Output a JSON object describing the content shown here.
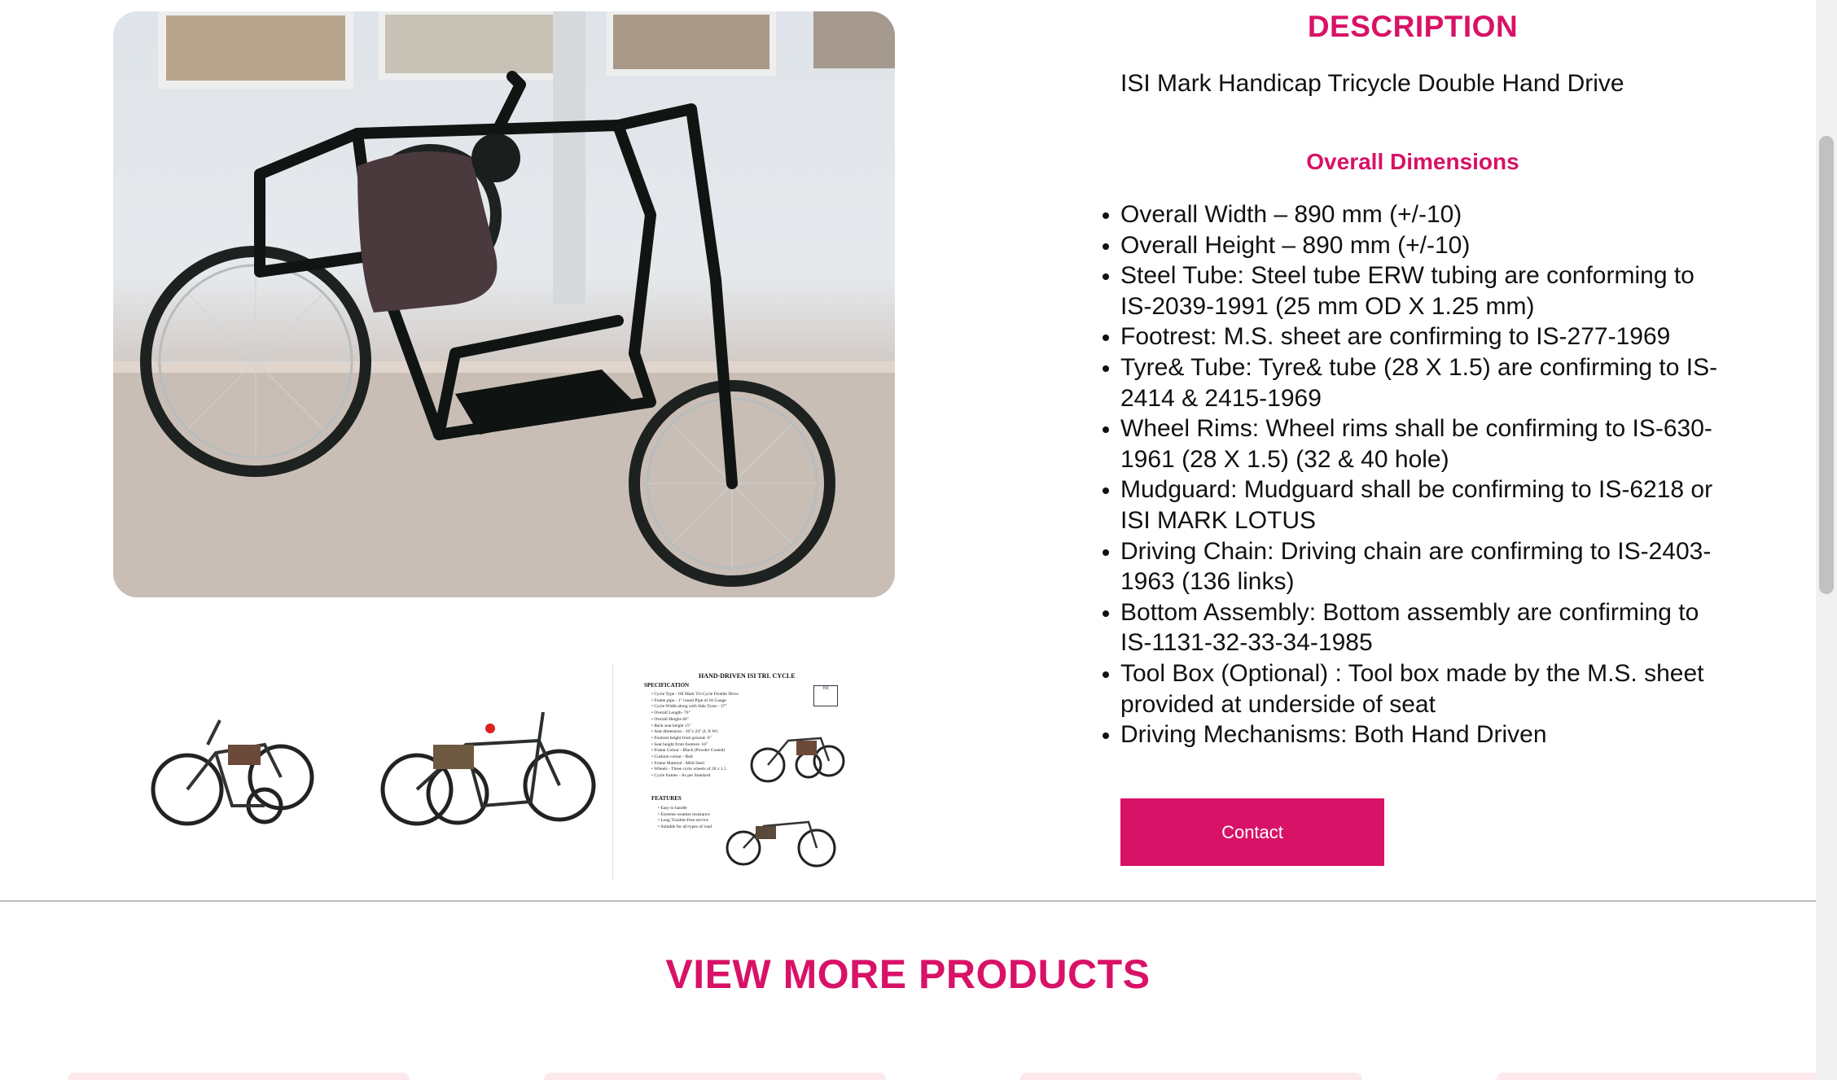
{
  "product": {
    "main_image_alt": "tricycle-photo",
    "description_heading": "DESCRIPTION",
    "name": "ISI Mark Handicap Tricycle Double Hand Drive",
    "dimensions_heading": "Overall Dimensions",
    "specs": [
      "Overall Width – 890 mm (+/-10)",
      "Overall Height – 890 mm (+/-10)",
      "Steel Tube: Steel tube ERW tubing are conforming to IS-2039-1991 (25 mm OD X 1.25 mm)",
      "Footrest: M.S. sheet are confirming to IS-277-1969",
      "Tyre& Tube: Tyre& tube (28 X 1.5) are confirming to IS-2414 & 2415-1969",
      "Wheel Rims: Wheel rims shall be confirming to IS-630-1961 (28 X 1.5) (32 & 40 hole)",
      "Mudguard: Mudguard shall be confirming to IS-6218 or ISI MARK LOTUS",
      "Driving Chain: Driving chain are confirming to IS-2403-1963 (136 links)",
      "Bottom Assembly: Bottom assembly are confirming to IS-1131-32-33-34-1985",
      "Tool Box (Optional) : Tool box made by the M.S. sheet provided at underside of seat",
      "Driving Mechanisms: Both Hand Driven"
    ],
    "contact_label": "Contact"
  },
  "spec_sheet": {
    "title": "HAND-DRIVEN ISI TRI. CYCLE",
    "spec_heading": "SPECIFICATION",
    "spec_lines": [
      "Cycle Type - ISI Mark Tri-Cycle Double Drive",
      "Frame pipe - 1\" round Pipe of 16 Gauge",
      "Cycle Width along with Side Tyres - 37\"",
      "Overall Length- 70\"",
      "Overall Height-40\"",
      "Back seat height 15\"",
      "Seat dimension - 16\"x 24\" (L X W)",
      "Footrest height from ground- 6\"",
      "Seat height from footrest- 16\"",
      "Frame Colour - Black (Powder Coated)",
      "Cushion colour - Red",
      "Frame Material - Mild Steel",
      "Wheels - Three cycle wheels of 28 x 1.5",
      "Cycle frames - As per Standard"
    ],
    "features_heading": "FEATURES",
    "feature_lines": [
      "Easy to handle",
      "Extreme weather resistance",
      "Long Trouble-Free service",
      "Suitable for all types of road"
    ],
    "isi_label": "ISI"
  },
  "view_more_heading": "VIEW MORE PRODUCTS",
  "colors": {
    "accent": "#d81266"
  }
}
